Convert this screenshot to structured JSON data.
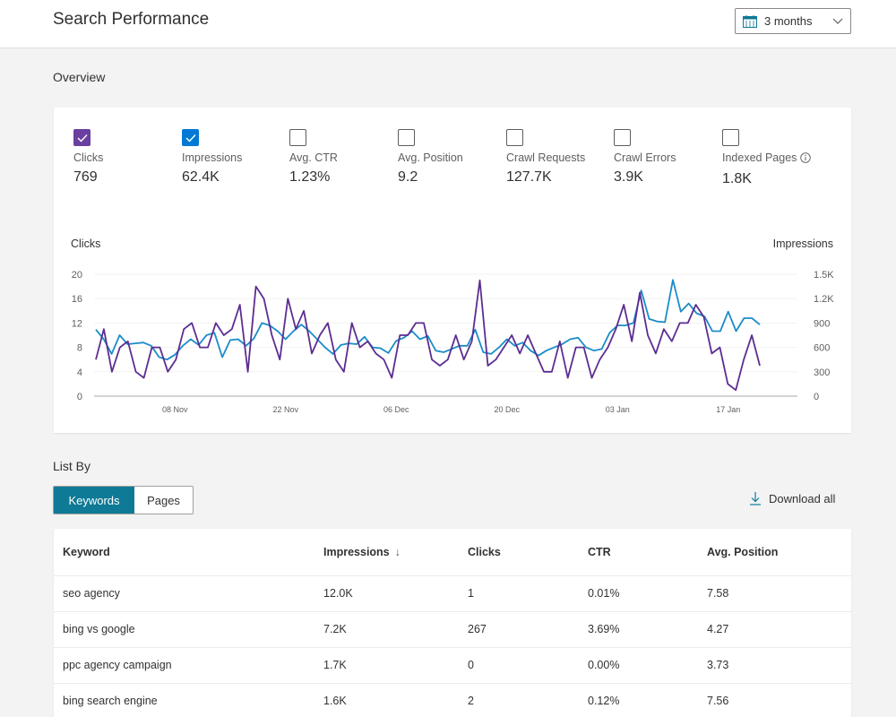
{
  "header": {
    "title": "Search Performance",
    "date_range": {
      "selected": "3 months",
      "icon": "calendar-icon"
    }
  },
  "overview": {
    "label": "Overview",
    "metrics": [
      {
        "label": "Clicks",
        "value": "769",
        "checked": true,
        "color": "#6b3fa0"
      },
      {
        "label": "Impressions",
        "value": "62.4K",
        "checked": true,
        "color": "#0078d4"
      },
      {
        "label": "Avg. CTR",
        "value": "1.23%",
        "checked": false
      },
      {
        "label": "Avg. Position",
        "value": "9.2",
        "checked": false
      },
      {
        "label": "Crawl Requests",
        "value": "127.7K",
        "checked": false
      },
      {
        "label": "Crawl Errors",
        "value": "3.9K",
        "checked": false
      },
      {
        "label": "Indexed Pages",
        "value": "1.8K",
        "checked": false,
        "info_icon": true
      }
    ]
  },
  "chart_data": {
    "type": "line",
    "title": "",
    "ylabel": "Clicks",
    "y2label": "Impressions",
    "ylim": [
      0,
      20
    ],
    "y2lim": [
      0,
      1500
    ],
    "yticks": [
      "0",
      "4",
      "8",
      "12",
      "16",
      "20"
    ],
    "y2ticks": [
      "0",
      "300",
      "600",
      "900",
      "1.2K",
      "1.5K"
    ],
    "xtick_labels": [
      "08 Nov",
      "22 Nov",
      "06 Dec",
      "20 Dec",
      "03 Jan",
      "17 Jan"
    ],
    "xtick_index": [
      10,
      24,
      38,
      52,
      66,
      80
    ],
    "grid": true,
    "legend": "none",
    "series": [
      {
        "name": "Clicks",
        "axis": "left",
        "color": "#5c2d91",
        "values": [
          6,
          11,
          4,
          8,
          9,
          4,
          3,
          8,
          8,
          4,
          6,
          11,
          12,
          8,
          8,
          12,
          10,
          11,
          15,
          4,
          18,
          16,
          10,
          6,
          16,
          11,
          14,
          7,
          10,
          12,
          6,
          4,
          12,
          8,
          9,
          7,
          6,
          3,
          10,
          10,
          12,
          12,
          6,
          5,
          6,
          10,
          6,
          9,
          19,
          5,
          6,
          8,
          10,
          7,
          10,
          7,
          4,
          4,
          9,
          3,
          8,
          8,
          3,
          6,
          8,
          11,
          15,
          9,
          17,
          10,
          7,
          11,
          9,
          12,
          12,
          15,
          13,
          7,
          8,
          2,
          1,
          6,
          10,
          5
        ]
      },
      {
        "name": "Impressions",
        "axis": "right",
        "color": "#1b8cc8",
        "values": [
          820,
          700,
          520,
          750,
          640,
          650,
          660,
          620,
          480,
          450,
          510,
          620,
          700,
          630,
          750,
          780,
          480,
          690,
          700,
          620,
          710,
          900,
          870,
          800,
          700,
          800,
          880,
          800,
          700,
          600,
          520,
          630,
          650,
          640,
          730,
          600,
          590,
          530,
          680,
          720,
          800,
          700,
          740,
          560,
          540,
          580,
          620,
          620,
          820,
          540,
          520,
          600,
          700,
          620,
          660,
          560,
          500,
          560,
          600,
          640,
          700,
          720,
          600,
          560,
          580,
          780,
          870,
          870,
          900,
          1300,
          950,
          920,
          910,
          1430,
          1040,
          1140,
          1020,
          980,
          800,
          800,
          1040,
          800,
          960,
          960,
          880
        ]
      }
    ]
  },
  "list_by": {
    "label": "List By",
    "tabs": [
      {
        "label": "Keywords",
        "active": true
      },
      {
        "label": "Pages",
        "active": false
      }
    ],
    "download_label": "Download all"
  },
  "table": {
    "columns": [
      "Keyword",
      "Impressions",
      "Clicks",
      "CTR",
      "Avg. Position"
    ],
    "sorted_column": "Impressions",
    "sort_direction": "descending",
    "rows": [
      [
        "seo agency",
        "12.0K",
        "1",
        "0.01%",
        "7.58"
      ],
      [
        "bing vs google",
        "7.2K",
        "267",
        "3.69%",
        "4.27"
      ],
      [
        "ppc agency campaign",
        "1.7K",
        "0",
        "0.00%",
        "3.73"
      ],
      [
        "bing search engine",
        "1.6K",
        "2",
        "0.12%",
        "7.56"
      ]
    ]
  }
}
